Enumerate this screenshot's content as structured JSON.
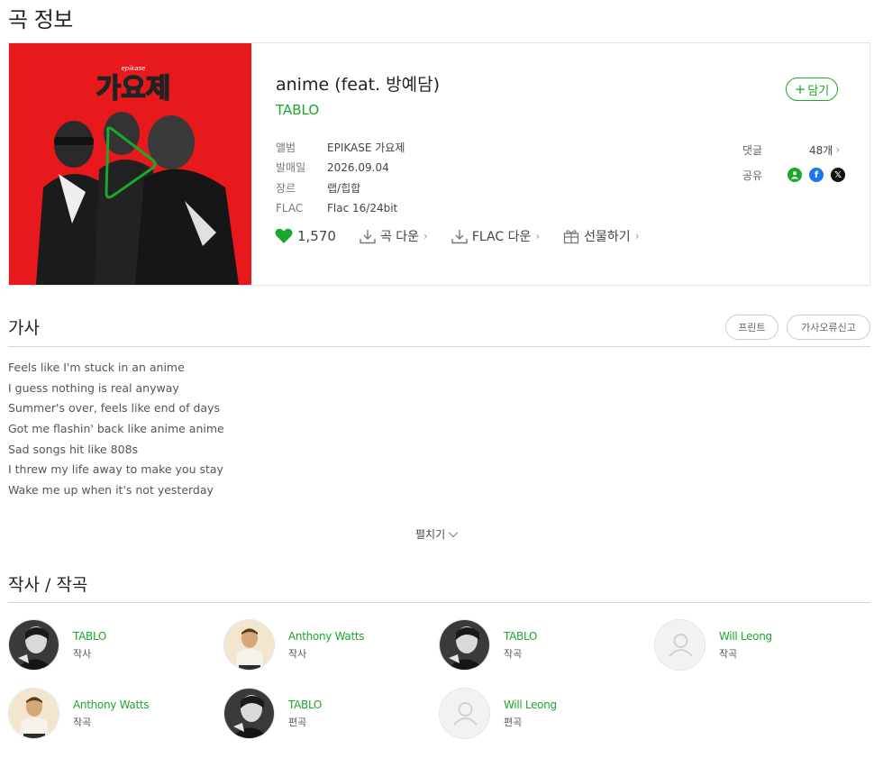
{
  "page": {
    "title": "곡 정보"
  },
  "song": {
    "title": "anime (feat. 방예담)",
    "artist": "TABLO",
    "add_label": "담기",
    "cover_text": "가요제",
    "cover_small_text": "epikase",
    "meta": [
      {
        "key": "앨범",
        "value": "EPIKASE 가요제"
      },
      {
        "key": "발매일",
        "value": "2026.09.04"
      },
      {
        "key": "장르",
        "value": "랩/힙합"
      },
      {
        "key": "FLAC",
        "value": "Flac 16/24bit"
      }
    ],
    "comments_label": "댓글",
    "comments_count": "48개",
    "share_label": "공유",
    "likes": "1,570",
    "download_label": "곡 다운",
    "flac_download_label": "FLAC 다운",
    "gift_label": "선물하기"
  },
  "lyrics": {
    "title": "가사",
    "print_label": "프린트",
    "report_label": "가사오류신고",
    "lines": [
      "Feels like I'm stuck in an anime",
      "I guess nothing is real anyway",
      "Summer's over, feels like end of days",
      "Got me flashin' back like anime anime",
      "Sad songs hit like 808s",
      "I threw my life away to make you stay",
      "Wake me up when it's not yesterday"
    ],
    "expand_label": "펼치기"
  },
  "credits": {
    "title": "작사 / 작곡",
    "items": [
      {
        "name": "TABLO",
        "role": "작사",
        "avatar": "photo-dark"
      },
      {
        "name": "Anthony Watts",
        "role": "작사",
        "avatar": "photo-light"
      },
      {
        "name": "TABLO",
        "role": "작곡",
        "avatar": "photo-dark"
      },
      {
        "name": "Will Leong",
        "role": "작곡",
        "avatar": "placeholder"
      },
      {
        "name": "Anthony Watts",
        "role": "작곡",
        "avatar": "photo-light"
      },
      {
        "name": "TABLO",
        "role": "편곡",
        "avatar": "photo-dark"
      },
      {
        "name": "Will Leong",
        "role": "편곡",
        "avatar": "placeholder"
      }
    ]
  },
  "colors": {
    "accent": "#1aa82a",
    "cover_bg": "#e8191c"
  }
}
